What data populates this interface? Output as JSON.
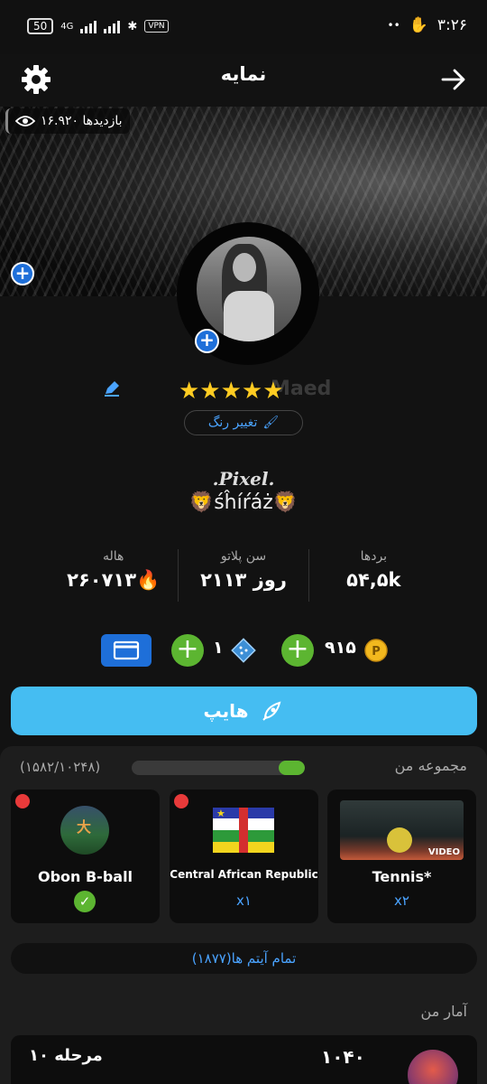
{
  "status_bar": {
    "battery": "50",
    "network": "4G",
    "vpn": "VPN",
    "time": "۳:۲۶",
    "dots": "••"
  },
  "header": {
    "title": "نمایه"
  },
  "cover": {
    "views": "۱۶.۹۲۰ بازدیدها"
  },
  "profile": {
    "name": "Maed",
    "stars": "★★★★★",
    "change_color": "تغییر رنگ",
    "tagline": ".Pixel.",
    "username": "🦁śĥíŕáż🦁"
  },
  "stats": [
    {
      "label": "بردها",
      "value": "۵۴,۵k"
    },
    {
      "label": "سن پلاتو",
      "value": "۲۱۱۳ روز"
    },
    {
      "label": "هاله",
      "value": "۲۶۰۷۱۳"
    }
  ],
  "currency": {
    "coins": "۹۱۵",
    "gems": "۱"
  },
  "hype": {
    "label": "هایپ"
  },
  "collection": {
    "title": "مجموعه من",
    "count": "(۱۵۸۲/۱۰۲۴۸)",
    "progress": 0.15,
    "cards": [
      {
        "title": "Tennis*",
        "sub": "x۲",
        "badge": "VIDEO"
      },
      {
        "title": "Central African Republic",
        "sub": "x۱"
      },
      {
        "title": "Obon B-ball",
        "check": "✓"
      }
    ],
    "all_items": "تمام آیتم ها(۱۸۷۷)"
  },
  "my_stats": {
    "title": "آمار من",
    "value": "۱۰۴۰",
    "stage": "مرحله ۱۰"
  },
  "colors": {
    "accent": "#1e6fd9",
    "hype": "#45bdf2",
    "green": "#5cb531",
    "star": "#ffcc22"
  }
}
